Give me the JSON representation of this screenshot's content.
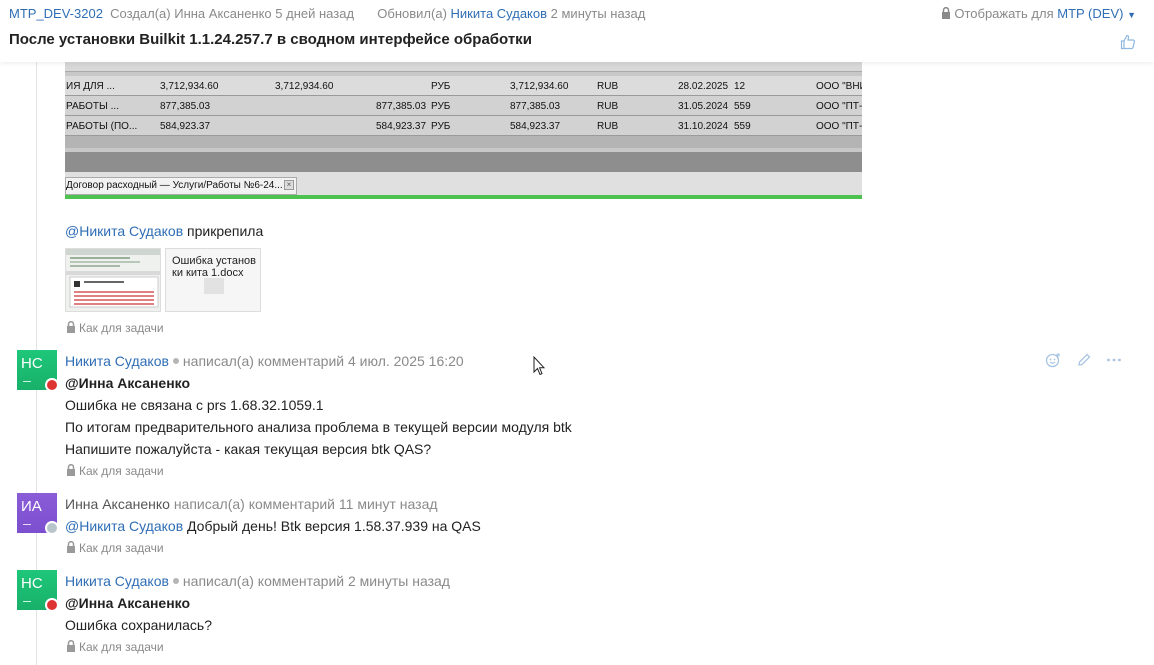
{
  "header": {
    "issue_key": "MTP_DEV-3202",
    "created_prefix": "Создал(а)",
    "created_by": "Инна Аксаненко",
    "created_when": "5 дней назад",
    "updated_prefix": "Обновил(а)",
    "updated_by": "Никита Судаков",
    "updated_when": "2 минуты назад",
    "visibility_prefix": "Отображать для",
    "visibility_value": "MTP (DEV)",
    "title": "После установки Builkit 1.1.24.257.7 в сводном интерфейсе обработки"
  },
  "screenshot": {
    "rows": [
      {
        "c1": "ИЯ ДЛЯ ...",
        "c2": "3,712,934.60",
        "c3": "3,712,934.60",
        "c4": "",
        "c5": "РУБ",
        "c6": "3,712,934.60",
        "c7": "RUB",
        "c8": "28.02.2025",
        "c9": "12",
        "c10": "ООО \"ВНИ"
      },
      {
        "c1": "РАБОТЫ ...",
        "c2": "877,385.03",
        "c3": "",
        "c4": "877,385.03",
        "c5": "РУБ",
        "c6": "877,385.03",
        "c7": "RUB",
        "c8": "31.05.2024",
        "c9": "559",
        "c10": "ООО \"ПТ-"
      },
      {
        "c1": "РАБОТЫ (ПО...",
        "c2": "584,923.37",
        "c3": "",
        "c4": "584,923.37",
        "c5": "РУБ",
        "c6": "584,923.37",
        "c7": "RUB",
        "c8": "31.10.2024",
        "c9": "559",
        "c10": "ООО \"ПТ-"
      }
    ],
    "tab_label": "Договор расходный — Услуги/Работы №6-24..."
  },
  "attachment": {
    "mention": "@Никита Судаков",
    "action": "прикрепила",
    "file_name": "Ошибка установки кита 1.docx"
  },
  "visibility_note": "Как для задачи",
  "comments": [
    {
      "initials": "НС",
      "author": "Никита Судаков",
      "action": "написал(а) комментарий",
      "when": "4 июл. 2025 16:20",
      "lines": [
        "@Инна Аксаненко",
        "Ошибка не связана с prs 1.68.32.1059.1",
        "По итогам предварительного анализа проблема в текущей версии модуля btk",
        "Напишите пожалуйста - какая текущая версия btk QAS?"
      ]
    },
    {
      "initials": "ИА",
      "author": "Инна Аксаненко",
      "action": "написал(а) комментарий",
      "when": "11 минут назад",
      "mention": "@Никита Судаков",
      "text": "Добрый день! Btk версия 1.58.37.939 на QAS"
    },
    {
      "initials": "НС",
      "author": "Никита Судаков",
      "action": "написал(а) комментарий",
      "when": "2 минуты назад",
      "lines": [
        "@Инна Аксаненко",
        "Ошибка сохранилась?"
      ]
    }
  ],
  "colors": {
    "link": "#2f6eb5",
    "avatar_green": "#1ec77a",
    "avatar_purple": "#7c4fd0"
  }
}
